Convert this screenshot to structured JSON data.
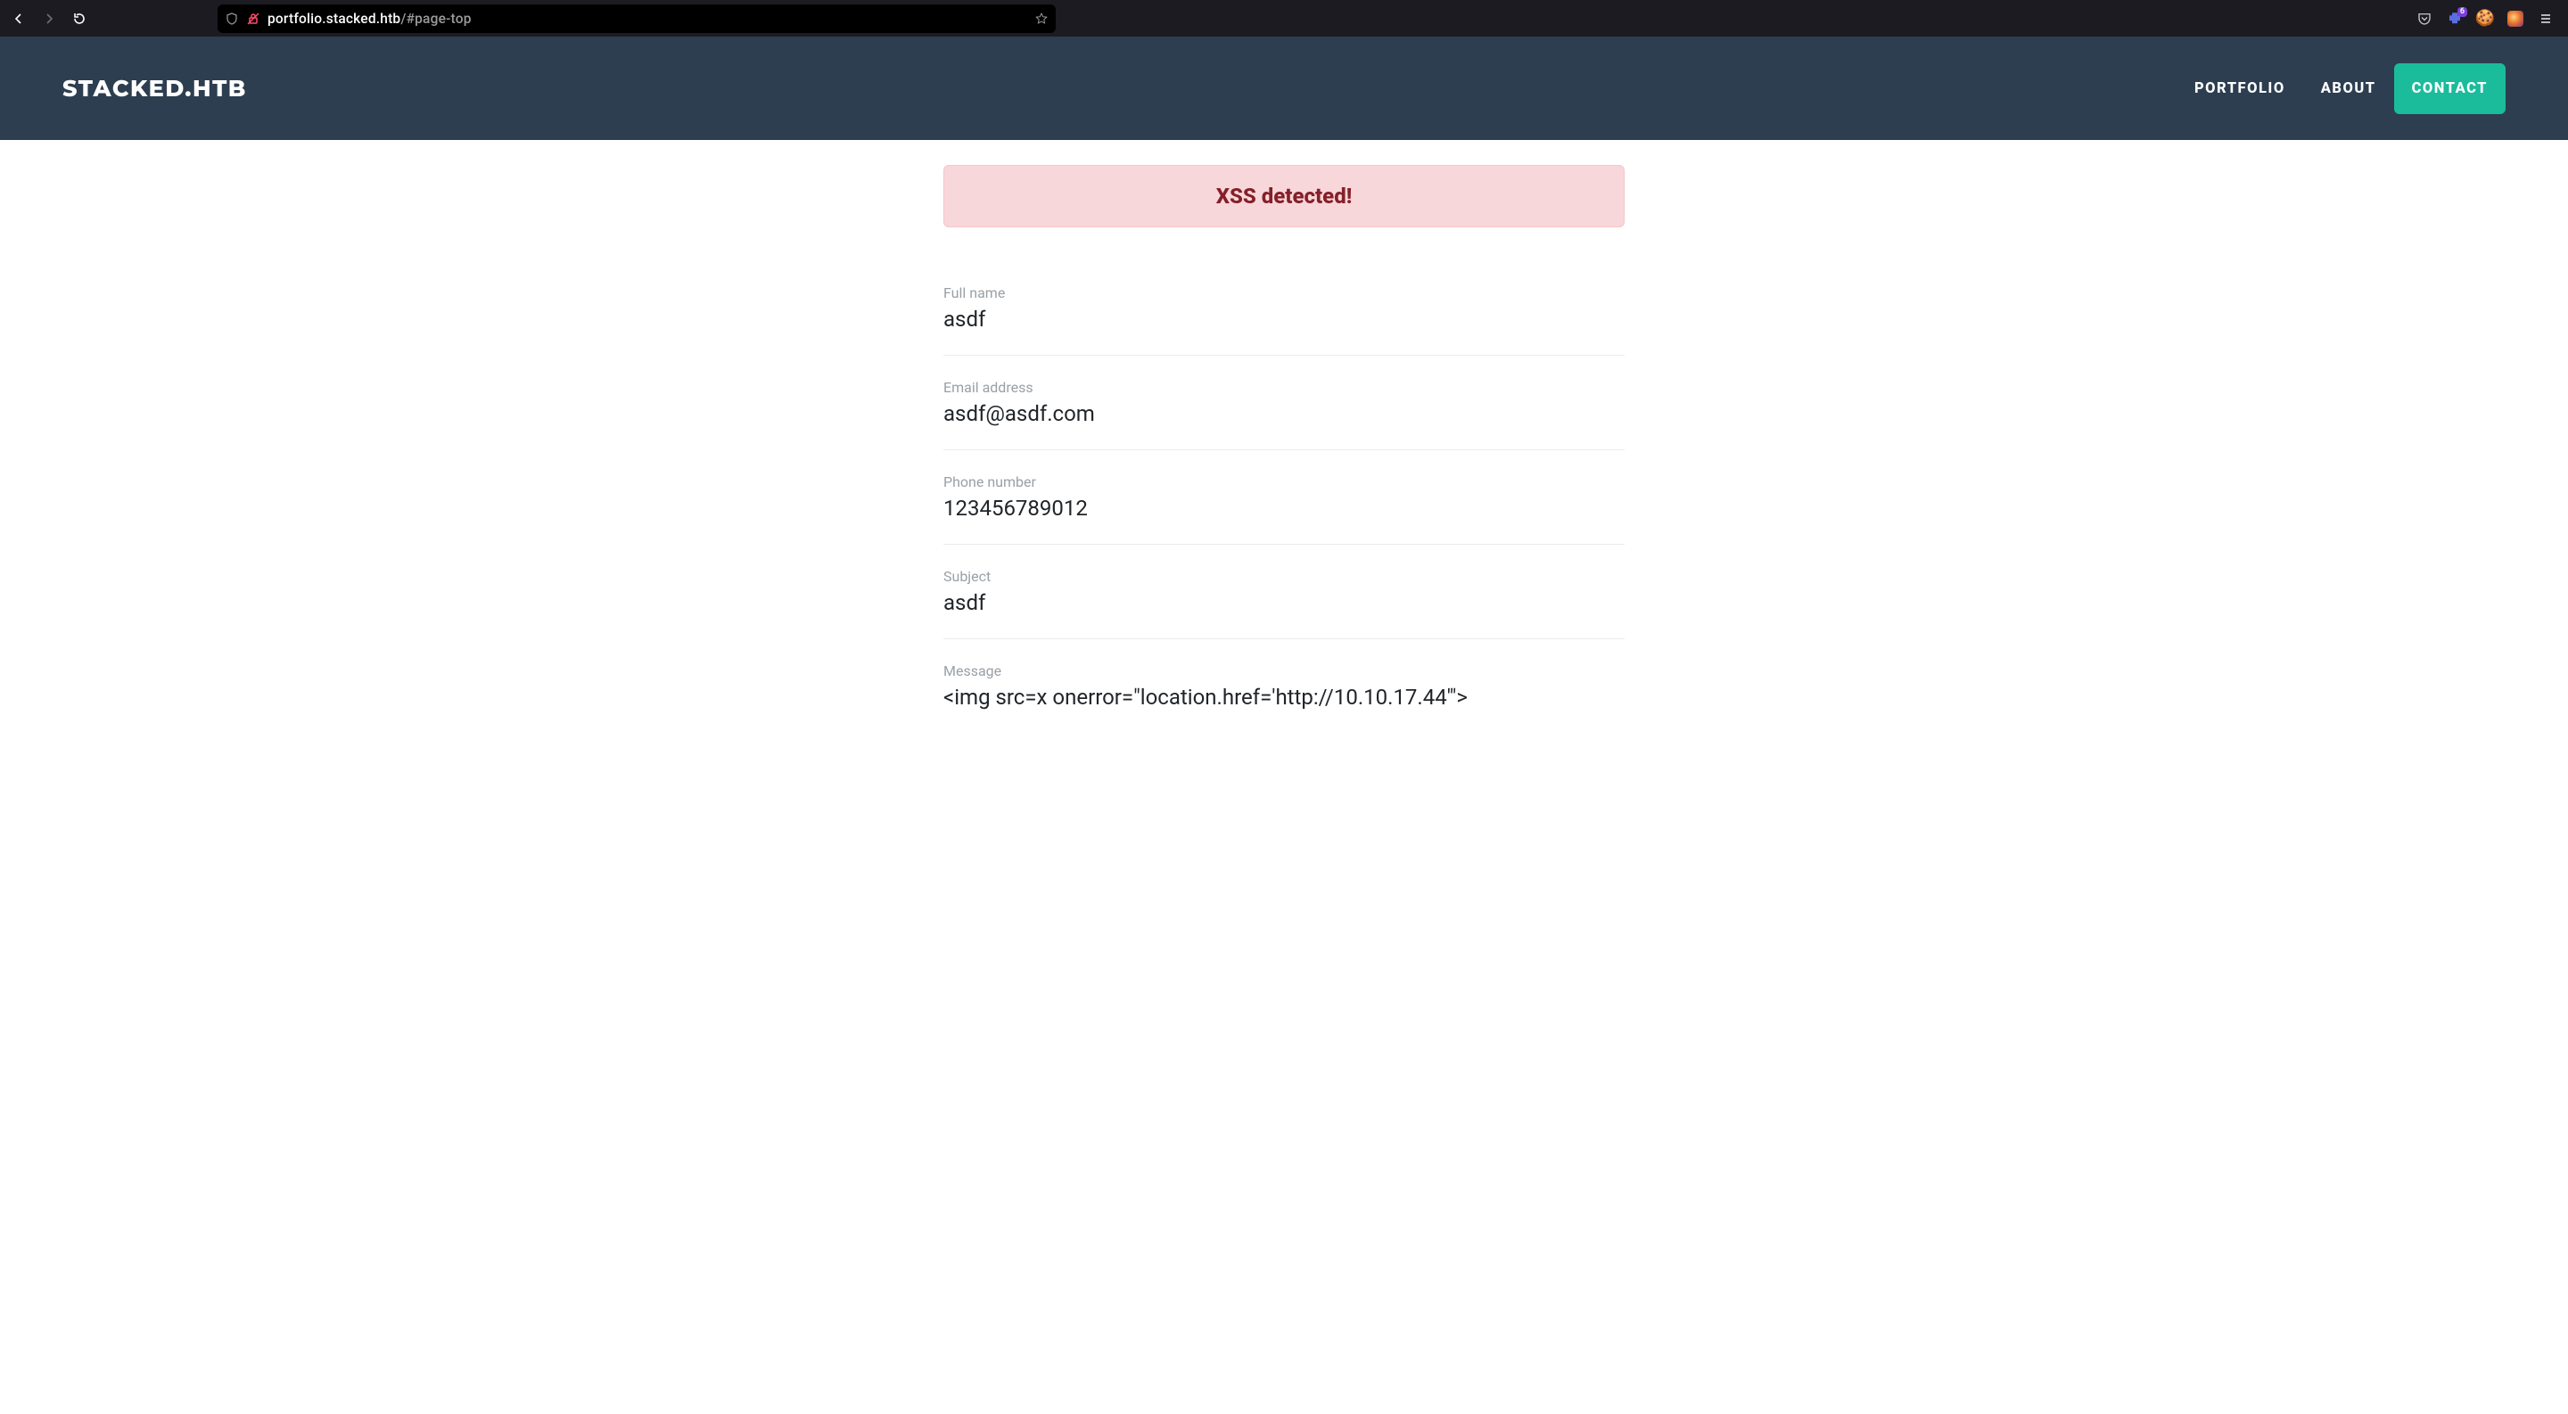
{
  "browser": {
    "url_host": "portfolio.stacked.htb",
    "url_path": "/#page-top",
    "extension_badge": "6"
  },
  "header": {
    "brand": "STACKED.HTB",
    "nav": [
      {
        "label": "PORTFOLIO",
        "active": false
      },
      {
        "label": "ABOUT",
        "active": false
      },
      {
        "label": "CONTACT",
        "active": true
      }
    ]
  },
  "alert": {
    "text": "XSS detected!"
  },
  "form": {
    "fullname": {
      "label": "Full name",
      "value": "asdf"
    },
    "email": {
      "label": "Email address",
      "value": "asdf@asdf.com"
    },
    "phone": {
      "label": "Phone number",
      "value": "123456789012"
    },
    "subject": {
      "label": "Subject",
      "value": "asdf"
    },
    "message": {
      "label": "Message",
      "value": "<img src=x onerror=\"location.href='http://10.10.17.44'\">"
    }
  }
}
